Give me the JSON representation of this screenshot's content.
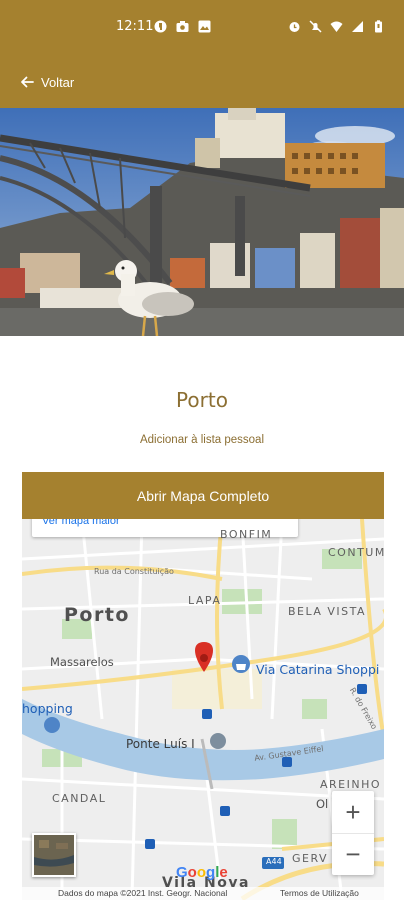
{
  "status_bar": {
    "time": "12:11",
    "left_icons": [
      "app-notification-icon",
      "camera-notification-icon",
      "image-notification-icon"
    ],
    "right_icons": [
      "alarm-icon",
      "mute-icon",
      "wifi-icon",
      "signal-icon",
      "battery-icon"
    ]
  },
  "app_bar": {
    "back_label": "Voltar"
  },
  "hero": {
    "subject": "Porto bridge and seagull photo"
  },
  "content": {
    "city_name": "Porto",
    "add_to_list": "Adicionar à lista pessoal",
    "open_map_button": "Abrir Mapa Completo"
  },
  "map": {
    "view_larger": "Ver mapa maior",
    "labels": {
      "city": "Porto",
      "bonfim": "BONFIM",
      "lapa": "LAPA",
      "bela_vista": "BELA VISTA",
      "massarelos": "Massarelos",
      "via_catarina": "Via Catarina Shoppi",
      "shopping": "hopping",
      "ponte": "Ponte Luís I",
      "candal": "CANDAL",
      "areinho": "AREINHO",
      "oliveira": "Ol",
      "gervide": "GERV",
      "vila_nova": "Vila Nova",
      "street_constituicao": "Rua da Constituição",
      "street_freixo": "R. do Freixo",
      "street_gustave": "Av. Gustave Eiffel",
      "road_a44": "A44",
      "cont": "CONTUM"
    },
    "google": "Google",
    "attribution": "Dados do mapa ©2021 Inst. Geogr. Nacional",
    "terms": "Termos de Utilização",
    "zoom_in": "+",
    "zoom_out": "−",
    "colors": {
      "water": "#a8c9e6",
      "park": "#c6e2b9",
      "road": "#ffffff",
      "major_road": "#f8dc88",
      "pin": "#d93025",
      "poi": "#1f5fb6"
    }
  },
  "colors": {
    "accent": "#a5812f",
    "title_text": "#8c6f33"
  }
}
